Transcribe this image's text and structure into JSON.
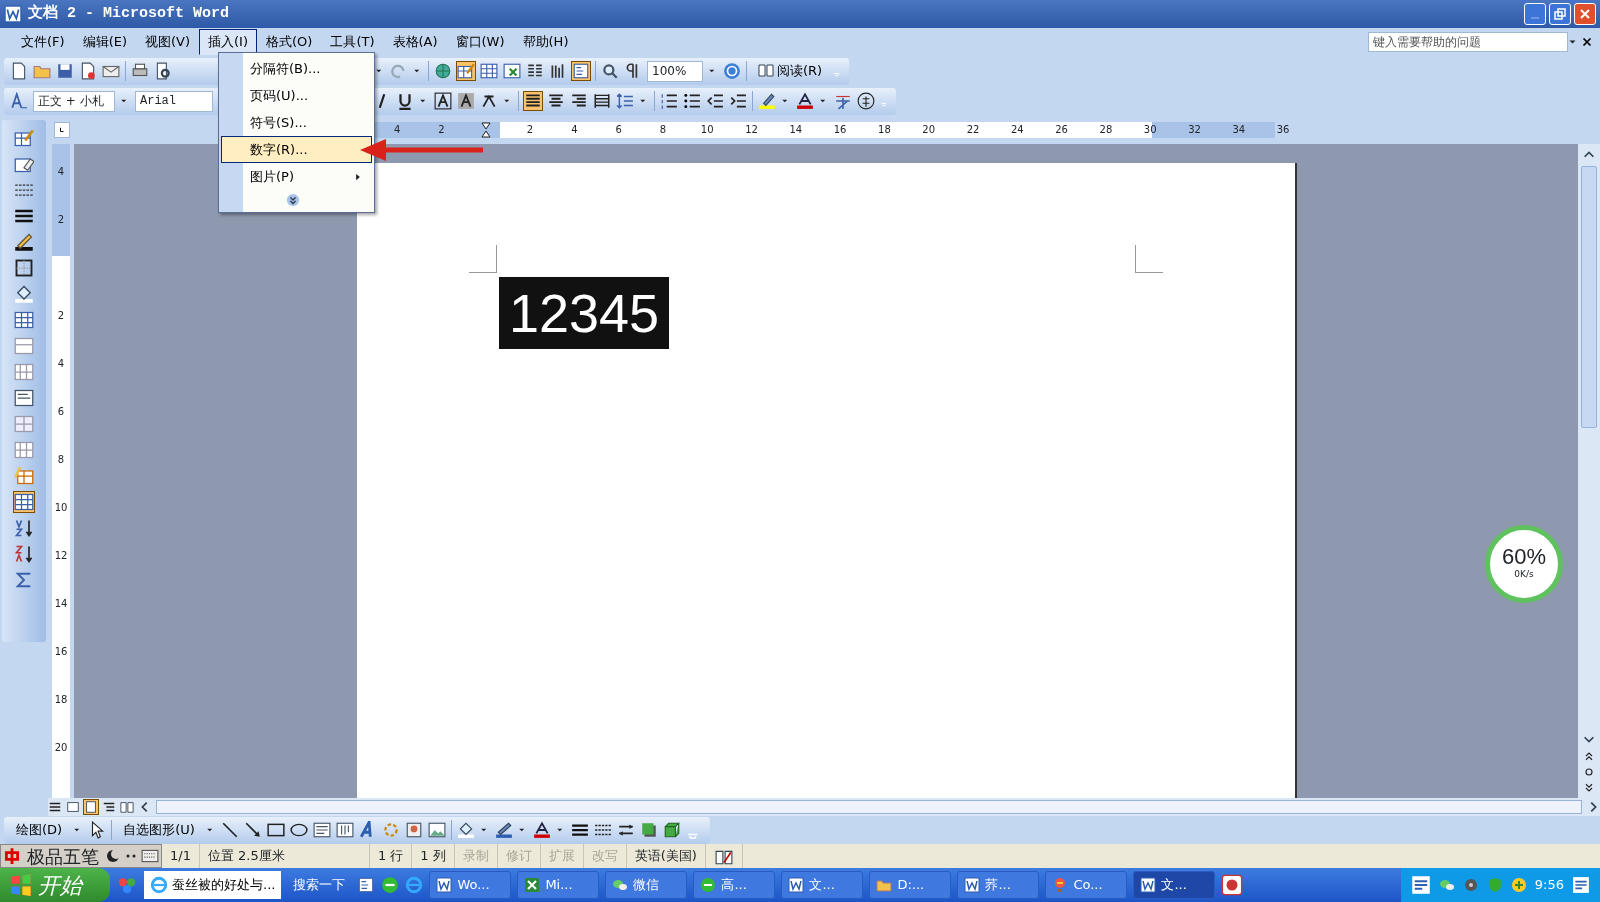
{
  "window": {
    "title": "文档 2 - Microsoft Word"
  },
  "menu_bar": {
    "items": [
      {
        "label": "文件(F)",
        "selected": false
      },
      {
        "label": "编辑(E)",
        "selected": false
      },
      {
        "label": "视图(V)",
        "selected": false
      },
      {
        "label": "插入(I)",
        "selected": true
      },
      {
        "label": "格式(O)",
        "selected": false
      },
      {
        "label": "工具(T)",
        "selected": false
      },
      {
        "label": "表格(A)",
        "selected": false
      },
      {
        "label": "窗口(W)",
        "selected": false
      },
      {
        "label": "帮助(H)",
        "selected": false
      }
    ],
    "help_box": {
      "placeholder": "键入需要帮助的问题"
    }
  },
  "insert_menu": {
    "items": [
      {
        "kind": "item",
        "label": "分隔符(B)...",
        "selected": false
      },
      {
        "kind": "item",
        "label": "页码(U)...",
        "selected": false
      },
      {
        "kind": "item",
        "label": "符号(S)...",
        "selected": false
      },
      {
        "kind": "item",
        "label": "数字(R)...",
        "selected": true
      },
      {
        "kind": "submenu",
        "label": "图片(P)",
        "selected": false
      },
      {
        "kind": "expand",
        "selected": false
      }
    ]
  },
  "standard_toolbar": {
    "zoom": "100%",
    "read_button": "阅读(R)"
  },
  "formatting_toolbar": {
    "style": "正文 + 小札",
    "font": "Arial"
  },
  "ruler": {
    "horizontal_margin_labels": [
      "4",
      "2"
    ],
    "horizontal_labels": [
      "2",
      "4",
      "6",
      "8",
      "10",
      "12",
      "14",
      "16",
      "18",
      "20",
      "22",
      "24",
      "26",
      "28",
      "30",
      "32",
      "34",
      "36"
    ],
    "vertical_margin_labels": [
      "4",
      "2"
    ],
    "vertical_labels": [
      "2",
      "4",
      "6",
      "8",
      "10",
      "12",
      "14",
      "16",
      "18",
      "20"
    ]
  },
  "document": {
    "text": "12345"
  },
  "drawing_toolbar": {
    "draw_menu": "绘图(D)",
    "autoshapes_menu": "自选图形(U)"
  },
  "ime_bar": {
    "name": "极品五笔"
  },
  "status_bar": {
    "fields": [
      {
        "text": "1/1",
        "disabled": false
      },
      {
        "text": "位置 2.5厘米",
        "disabled": false
      },
      {
        "text": "1 行",
        "disabled": false
      },
      {
        "text": "1 列",
        "disabled": false
      },
      {
        "text": "录制",
        "disabled": true
      },
      {
        "text": "修订",
        "disabled": true
      },
      {
        "text": "扩展",
        "disabled": true
      },
      {
        "text": "改写",
        "disabled": true
      },
      {
        "text": "英语(美国)",
        "disabled": false
      }
    ]
  },
  "taskbar": {
    "start": "开始",
    "address_box": "蚕丝被的好处与...",
    "search_button": "搜索一下",
    "tasks": [
      {
        "label": "Wo...",
        "selected": false
      },
      {
        "label": "Mi...",
        "selected": false
      },
      {
        "label": "微信",
        "selected": false
      },
      {
        "label": "高...",
        "selected": false
      },
      {
        "label": "文...",
        "selected": false
      },
      {
        "label": "D:...",
        "selected": false
      },
      {
        "label": "荞...",
        "selected": false
      },
      {
        "label": "Co...",
        "selected": false
      },
      {
        "label": "文...",
        "selected": true
      }
    ],
    "clock": "9:56"
  },
  "network_widget": {
    "percent": "60%",
    "speed": "0K/s"
  }
}
